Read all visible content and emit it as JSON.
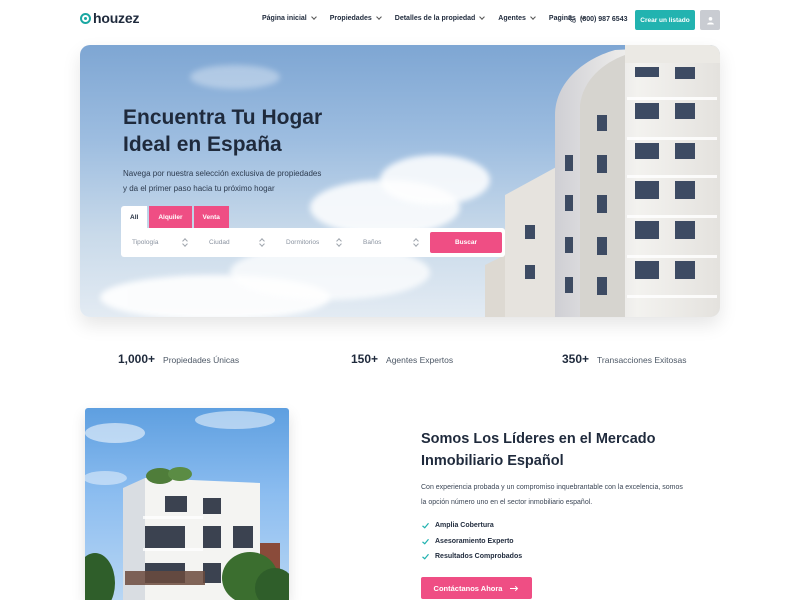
{
  "header": {
    "logo_text": "houzez",
    "nav": [
      {
        "label": "Página inicial"
      },
      {
        "label": "Propiedades"
      },
      {
        "label": "Detalles de la propiedad"
      },
      {
        "label": "Agentes"
      },
      {
        "label": "Paginas"
      }
    ],
    "phone": "(800) 987 6543",
    "cta_label": "Crear un listado"
  },
  "hero": {
    "title_line1": "Encuentra Tu Hogar",
    "title_line2": "Ideal en España",
    "subtitle_line1": "Navega por nuestra selección exclusiva de propiedades",
    "subtitle_line2": "y da el primer paso hacia tu próximo hogar",
    "tabs": [
      {
        "label": "All"
      },
      {
        "label": "Alquiler"
      },
      {
        "label": "Venta"
      }
    ],
    "fields": [
      {
        "placeholder": "Tipología"
      },
      {
        "placeholder": "Ciudad"
      },
      {
        "placeholder": "Dormitorios"
      },
      {
        "placeholder": "Baños"
      }
    ],
    "search_label": "Buscar"
  },
  "stats": [
    {
      "value": "1,000+",
      "label": "Propiedades Únicas"
    },
    {
      "value": "150+",
      "label": "Agentes Expertos"
    },
    {
      "value": "350+",
      "label": "Transacciones Exitosas"
    }
  ],
  "about": {
    "title_line1": "Somos Los Líderes en el Mercado",
    "title_line2": "Inmobiliario Español",
    "text_line1": "Con experiencia probada y un compromiso inquebrantable con la excelencia, somos",
    "text_line2": "la opción número uno en el sector inmobiliario español.",
    "checks": [
      {
        "label": "Amplia Cobertura"
      },
      {
        "label": "Asesoramiento Experto"
      },
      {
        "label": "Resultados Comprobados"
      }
    ],
    "contact_label": "Contáctanos Ahora"
  },
  "colors": {
    "accent_teal": "#22b3b0",
    "accent_pink": "#ef4e84",
    "text_dark": "#1f2a3c"
  },
  "icons": [
    "logo-mark-icon",
    "chevron-down-icon",
    "phone-icon",
    "user-icon",
    "select-arrows-icon",
    "check-icon",
    "arrow-right-icon"
  ]
}
